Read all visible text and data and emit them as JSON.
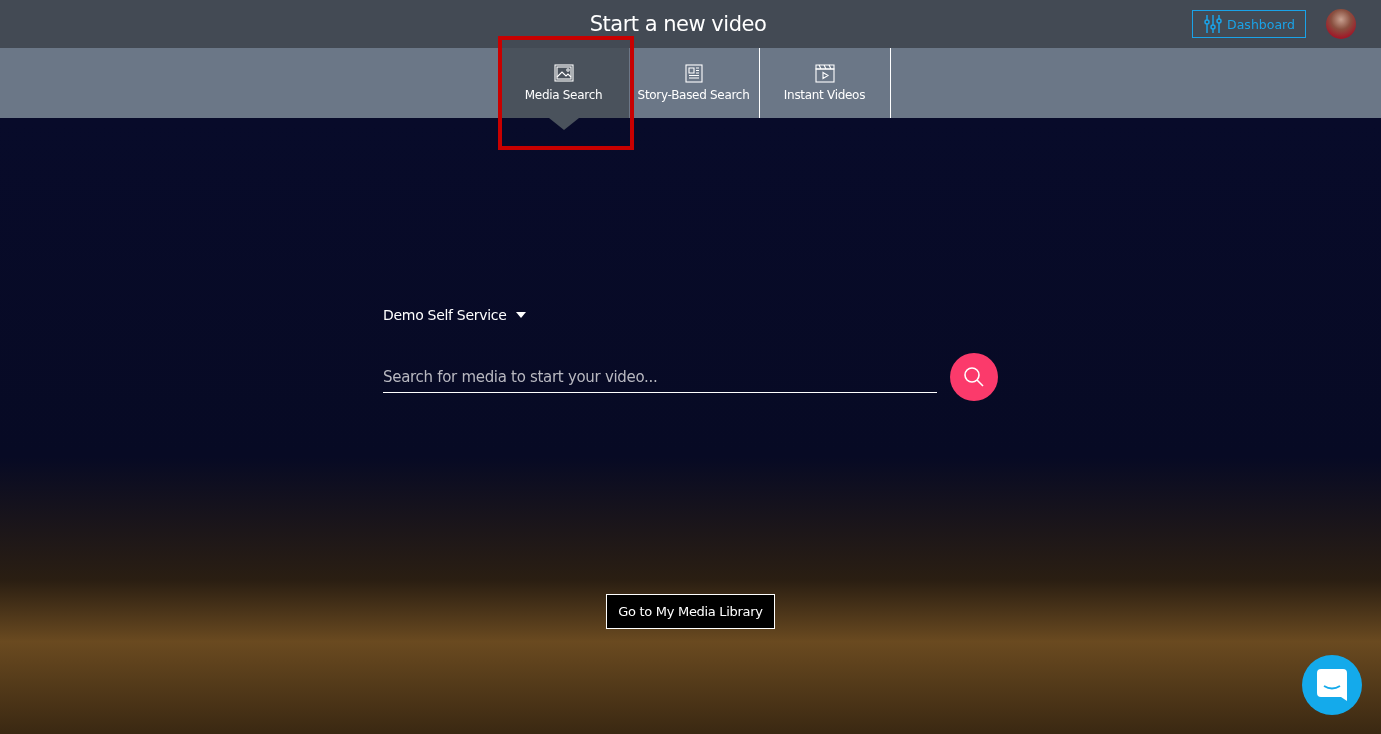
{
  "header": {
    "title": "Start a new video",
    "dashboard_button": "Dashboard"
  },
  "tabs": [
    {
      "label": "Media Search",
      "kind": "image",
      "selected": true,
      "highlighted": true
    },
    {
      "label": "Story-Based Search",
      "kind": "article",
      "selected": false,
      "highlighted": false
    },
    {
      "label": "Instant Videos",
      "kind": "clapper",
      "selected": false,
      "highlighted": false
    }
  ],
  "account_dropdown": {
    "label": "Demo Self Service"
  },
  "search": {
    "placeholder": "Search for media to start your video..."
  },
  "library_button": "Go to My Media Library"
}
